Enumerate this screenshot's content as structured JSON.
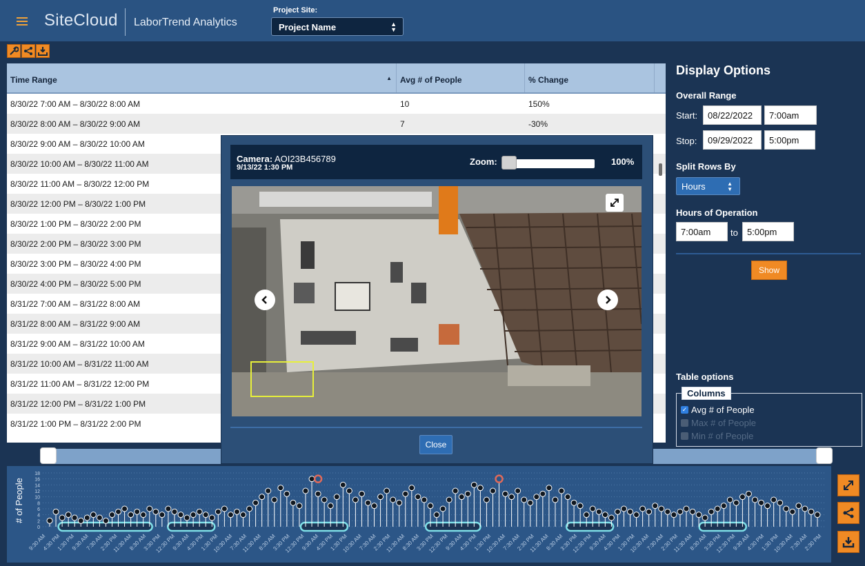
{
  "header": {
    "logo": "SiteCloud",
    "app_name": "LaborTrend Analytics",
    "project_site_label": "Project Site:",
    "project_site_value": "Project Name"
  },
  "toolbar": {
    "icons": [
      "wrench-icon",
      "share-icon",
      "download-icon"
    ]
  },
  "table": {
    "columns": [
      "Time Range",
      "Avg # of People",
      "% Change"
    ],
    "rows": [
      [
        "8/30/22 7:00 AM – 8/30/22 8:00 AM",
        "10",
        "150%"
      ],
      [
        "8/30/22 8:00 AM – 8/30/22 9:00 AM",
        "7",
        "-30%"
      ],
      [
        "8/30/22 9:00 AM – 8/30/22 10:00 AM",
        "",
        ""
      ],
      [
        "8/30/22 10:00 AM – 8/30/22 11:00 AM",
        "",
        ""
      ],
      [
        "8/30/22 11:00 AM – 8/30/22 12:00 PM",
        "",
        ""
      ],
      [
        "8/30/22 12:00 PM – 8/30/22 1:00 PM",
        "",
        ""
      ],
      [
        "8/30/22 1:00 PM – 8/30/22 2:00 PM",
        "",
        ""
      ],
      [
        "8/30/22 2:00 PM – 8/30/22 3:00 PM",
        "",
        ""
      ],
      [
        "8/30/22 3:00 PM – 8/30/22 4:00 PM",
        "",
        ""
      ],
      [
        "8/30/22 4:00 PM – 8/30/22 5:00 PM",
        "",
        ""
      ],
      [
        "8/31/22 7:00 AM – 8/31/22 8:00 AM",
        "",
        ""
      ],
      [
        "8/31/22 8:00 AM – 8/31/22 9:00 AM",
        "",
        ""
      ],
      [
        "8/31/22 9:00 AM – 8/31/22 10:00 AM",
        "",
        ""
      ],
      [
        "8/31/22 10:00 AM – 8/31/22 11:00 AM",
        "",
        ""
      ],
      [
        "8/31/22 11:00 AM – 8/31/22 12:00 PM",
        "",
        ""
      ],
      [
        "8/31/22 12:00 PM – 8/31/22 1:00 PM",
        "",
        ""
      ],
      [
        "8/31/22 1:00 PM – 8/31/22 2:00 PM",
        "",
        ""
      ]
    ]
  },
  "display_options": {
    "title": "Display Options",
    "overall_range": "Overall Range",
    "start_label": "Start:",
    "start_date": "08/22/2022",
    "start_time": "7:00am",
    "stop_label": "Stop:",
    "stop_date": "09/29/2022",
    "stop_time": "5:00pm",
    "split_rows_by": "Split Rows By",
    "split_value": "Hours",
    "hours_of_operation": "Hours of Operation",
    "hours_from": "7:00am",
    "hours_to_label": "to",
    "hours_to": "5:00pm",
    "show_button": "Show",
    "table_options": "Table options",
    "columns_legend": "Columns",
    "column_options": [
      {
        "label": "Avg # of People",
        "checked": true
      },
      {
        "label": "Max # of People",
        "checked": false
      },
      {
        "label": "Min # of People",
        "checked": false
      }
    ]
  },
  "modal": {
    "camera_prefix": "Camera:",
    "camera_id": "AOI23B456789",
    "timestamp": "9/13/22 1:30 PM",
    "zoom_label": "Zoom:",
    "zoom_value": "100%",
    "zoom_level": 0,
    "close_button": "Close"
  },
  "timeline": {
    "range_start_fraction": 0.0,
    "range_end_fraction": 1.0
  },
  "chart_data": {
    "type": "scatter",
    "ylabel": "# of People",
    "y_ticks": [
      "0",
      "2",
      "4",
      "6",
      "8",
      "10",
      "12",
      "14",
      "16",
      "18"
    ],
    "ylim": [
      0,
      18
    ],
    "x_tick_labels": [
      "9:30 AM",
      "4:30 PM",
      "1:30 PM",
      "9:30 AM",
      "7:30 AM",
      "2:30 PM",
      "11:30 AM",
      "8:30 AM",
      "3:30 PM",
      "12:30 PM",
      "9:30 AM",
      "4:30 PM",
      "1:30 PM",
      "10:30 AM",
      "7:30 AM",
      "11:30 AM",
      "8:30 AM",
      "3:30 PM",
      "12:30 PM",
      "9:30 AM",
      "4:30 PM",
      "1:30 PM",
      "10:30 AM",
      "7:30 AM",
      "2:30 PM",
      "11:30 AM",
      "8:30 AM",
      "3:30 PM",
      "12:30 PM",
      "9:30 AM",
      "4:30 PM",
      "1:30 PM",
      "10:30 AM",
      "7:30 AM",
      "2:30 PM",
      "11:30 AM",
      "8:30 AM",
      "3:30 PM",
      "12:30 PM",
      "9:30 AM",
      "4:30 PM",
      "1:30 PM",
      "10:30 AM",
      "7:30 AM",
      "2:30 PM",
      "11:30 AM",
      "8:30 AM",
      "3:30 PM",
      "12:30 PM",
      "9:30 AM",
      "4:30 PM",
      "1:30 PM",
      "10:30 AM",
      "7:30 AM",
      "2:30 PM"
    ],
    "values": [
      2,
      5,
      3,
      4,
      3,
      2,
      3,
      4,
      3,
      2,
      4,
      5,
      6,
      4,
      5,
      4,
      6,
      5,
      4,
      6,
      5,
      4,
      3,
      4,
      5,
      4,
      3,
      5,
      6,
      4,
      5,
      4,
      6,
      8,
      10,
      12,
      9,
      13,
      11,
      8,
      7,
      12,
      16,
      11,
      9,
      7,
      10,
      14,
      12,
      9,
      11,
      8,
      7,
      10,
      12,
      9,
      8,
      11,
      13,
      10,
      9,
      7,
      4,
      6,
      9,
      12,
      10,
      11,
      14,
      13,
      9,
      12,
      16,
      11,
      10,
      12,
      9,
      8,
      10,
      11,
      13,
      9,
      12,
      10,
      8,
      7,
      4,
      6,
      5,
      4,
      3,
      5,
      6,
      5,
      4,
      6,
      5,
      7,
      6,
      5,
      4,
      5,
      6,
      5,
      4,
      3,
      5,
      6,
      7,
      9,
      8,
      10,
      11,
      9,
      8,
      7,
      9,
      8,
      6,
      5,
      7,
      6,
      5,
      4
    ],
    "idle_segments_x_fraction": [
      [
        0.02,
        0.14
      ],
      [
        0.16,
        0.22
      ],
      [
        0.33,
        0.39
      ],
      [
        0.49,
        0.56
      ],
      [
        0.67,
        0.73
      ],
      [
        0.84,
        0.9
      ]
    ],
    "highlight_points": [
      {
        "index": 43,
        "value": 16,
        "color": "#e06a5a"
      },
      {
        "index": 72,
        "value": 16,
        "color": "#e06a5a"
      }
    ]
  },
  "side_buttons": [
    "expand-icon",
    "share-icon",
    "download-icon"
  ],
  "colors": {
    "accent": "#f08a24",
    "header_bg": "#2a5382",
    "panel_bg": "#1b3454",
    "table_header": "#aac4e0"
  }
}
